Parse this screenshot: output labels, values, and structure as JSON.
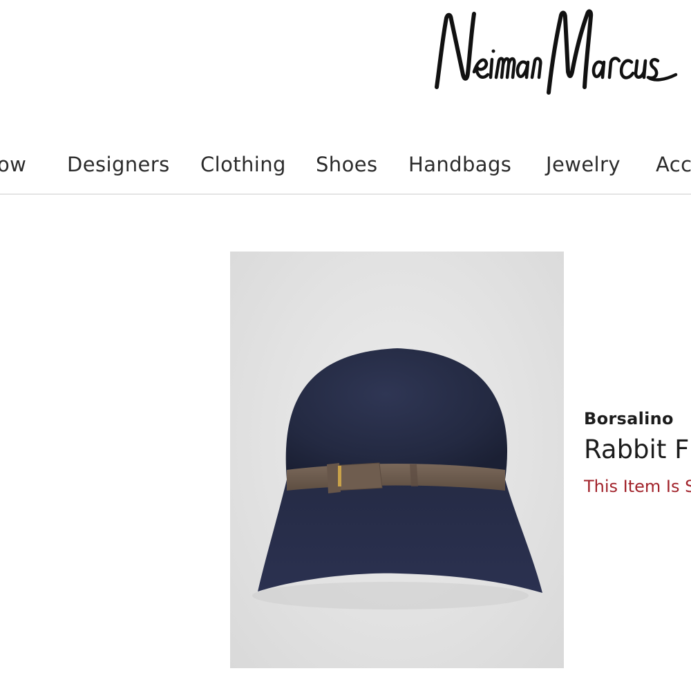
{
  "brand": {
    "name": "Neiman Marcus",
    "color": "#111111"
  },
  "nav": {
    "items": [
      {
        "label": "ow"
      },
      {
        "label": "Designers"
      },
      {
        "label": "Clothing"
      },
      {
        "label": "Shoes"
      },
      {
        "label": "Handbags"
      },
      {
        "label": "Jewelry"
      },
      {
        "label": "Acc"
      }
    ]
  },
  "product": {
    "designer": "Borsalino",
    "name": "Rabbit F",
    "stock_message": "This Item Is S",
    "stock_color": "#a1222a",
    "image": {
      "subject": "navy felt cloche hat with brown grosgrain band",
      "hat_color": "#252b45",
      "band_color": "#6e5c4e",
      "background_color": "#e3e3e3"
    }
  }
}
